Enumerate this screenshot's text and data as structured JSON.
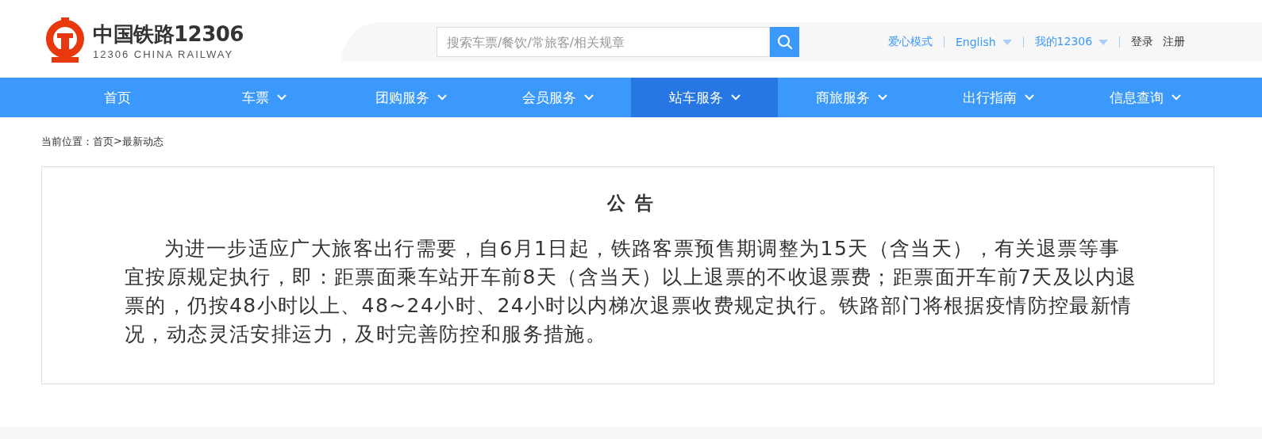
{
  "logo": {
    "title": "中国铁路12306",
    "subtitle": "12306 CHINA RAILWAY"
  },
  "search": {
    "placeholder": "搜索车票/餐饮/常旅客/相关规章"
  },
  "top_links": [
    {
      "label": "爱心模式",
      "kind": "link",
      "dropdown": false
    },
    {
      "label": "English",
      "kind": "link",
      "dropdown": true
    },
    {
      "label": "我的12306",
      "kind": "link",
      "dropdown": true
    },
    {
      "label": "登录",
      "kind": "auth",
      "dropdown": false
    },
    {
      "label": "注册",
      "kind": "auth",
      "dropdown": false
    }
  ],
  "nav": [
    {
      "label": "首页",
      "dropdown": false,
      "selected": false
    },
    {
      "label": "车票",
      "dropdown": true,
      "selected": false
    },
    {
      "label": "团购服务",
      "dropdown": true,
      "selected": false
    },
    {
      "label": "会员服务",
      "dropdown": true,
      "selected": false
    },
    {
      "label": "站车服务",
      "dropdown": true,
      "selected": true
    },
    {
      "label": "商旅服务",
      "dropdown": true,
      "selected": false
    },
    {
      "label": "出行指南",
      "dropdown": true,
      "selected": false
    },
    {
      "label": "信息查询",
      "dropdown": true,
      "selected": false
    }
  ],
  "breadcrumb": {
    "label": "当前位置：",
    "items": [
      "首页",
      ">",
      "最新动态"
    ]
  },
  "notice": {
    "title": "公 告",
    "body": "为进一步适应广大旅客出行需要，自6月1日起，铁路客票预售期调整为15天（含当天），有关退票等事宜按原规定执行，即：距票面乘车站开车前8天（含当天）以上退票的不收退票费；距票面开车前7天及以内退票的，仍按48小时以上、48~24小时、24小时以内梯次退票收费规定执行。铁路部门将根据疫情防控最新情况，动态灵活安排运力，及时完善防控和服务措施。"
  }
}
